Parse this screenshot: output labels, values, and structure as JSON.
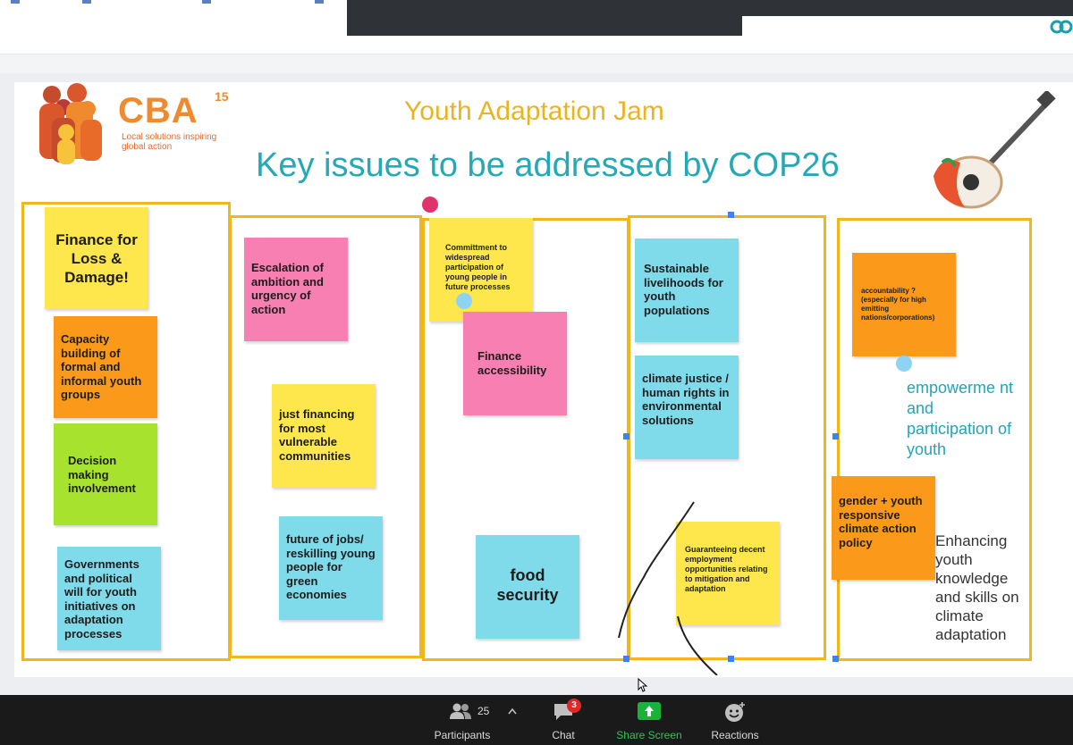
{
  "slide": {
    "logo_text": "CBA",
    "logo_superscript": "15",
    "logo_tagline": "Local solutions inspiring global action",
    "title": "Youth Adaptation Jam",
    "subtitle": "Key issues to be addressed by COP26"
  },
  "notes": {
    "col1": [
      "Finance for Loss & Damage!",
      "Capacity building of formal and informal youth groups",
      "Decision making involvement",
      "Governments and political will for youth initiatives on adaptation processes"
    ],
    "col2": [
      "Escalation of ambition and urgency of action",
      "just financing for most vulnerable communities",
      "future of jobs/ reskilling young people for green economies"
    ],
    "col3": [
      "Committment to widespread participation of young people in future processes",
      "Finance accessibility",
      "food security"
    ],
    "col4": [
      "Sustainable livelihoods for youth populations",
      "climate justice / human rights in environmental solutions",
      "Guaranteeing decent employment opportunities relating to mitigation and adaptation"
    ],
    "col5": [
      "accountability ? (especially for high emitting nations/corporations)",
      "gender + youth responsive climate action policy"
    ]
  },
  "freetext": {
    "empowerment": "empowerme nt and participation of youth",
    "enhancing": "Enhancing youth knowledge and skills on climate adaptation"
  },
  "toolbar": {
    "participants_label": "Participants",
    "participants_count": "25",
    "chat_label": "Chat",
    "chat_badge": "3",
    "share_label": "Share Screen",
    "reactions_label": "Reactions"
  },
  "colors": {
    "title": "#e9b421",
    "subtitle": "#26a9b7",
    "column_border": "#f2b51a",
    "share_green": "#1bb23b",
    "badge_red": "#e02828"
  }
}
